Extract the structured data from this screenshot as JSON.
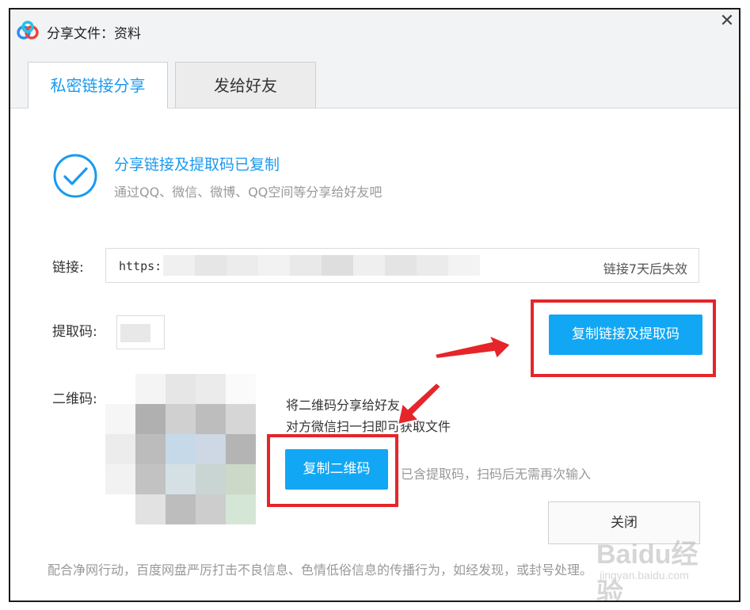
{
  "window": {
    "title": "分享文件：资料",
    "close_glyph": "✕"
  },
  "tabs": [
    {
      "label": "私密链接分享",
      "active": true
    },
    {
      "label": "发给好友",
      "active": false
    }
  ],
  "status": {
    "icon": "check-circle-icon",
    "title": "分享链接及提取码已复制",
    "subtitle": "通过QQ、微信、微博、QQ空间等分享给好友吧"
  },
  "link": {
    "label": "链接:",
    "value_prefix": "https:",
    "expiry": "链接7天后失效"
  },
  "code": {
    "label": "提取码:"
  },
  "buttons": {
    "copy_link_and_code": "复制链接及提取码",
    "copy_qr": "复制二维码",
    "close": "关闭"
  },
  "qr": {
    "label": "二维码:",
    "line1": "将二维码分享给好友",
    "line2": "对方微信扫一扫即可获取文件",
    "note": "已含提取码，扫码后无需再次输入"
  },
  "footer": "配合净网行动，百度网盘严厉打击不良信息、色情低俗信息的传播行为，如经发现，或封号处理。",
  "watermark": {
    "brand": "Baidu经验",
    "url": "jingyan.baidu.com"
  },
  "colors": {
    "accent": "#11a7f5",
    "accent_text": "#1a9aef",
    "highlight": "#e5252a"
  }
}
